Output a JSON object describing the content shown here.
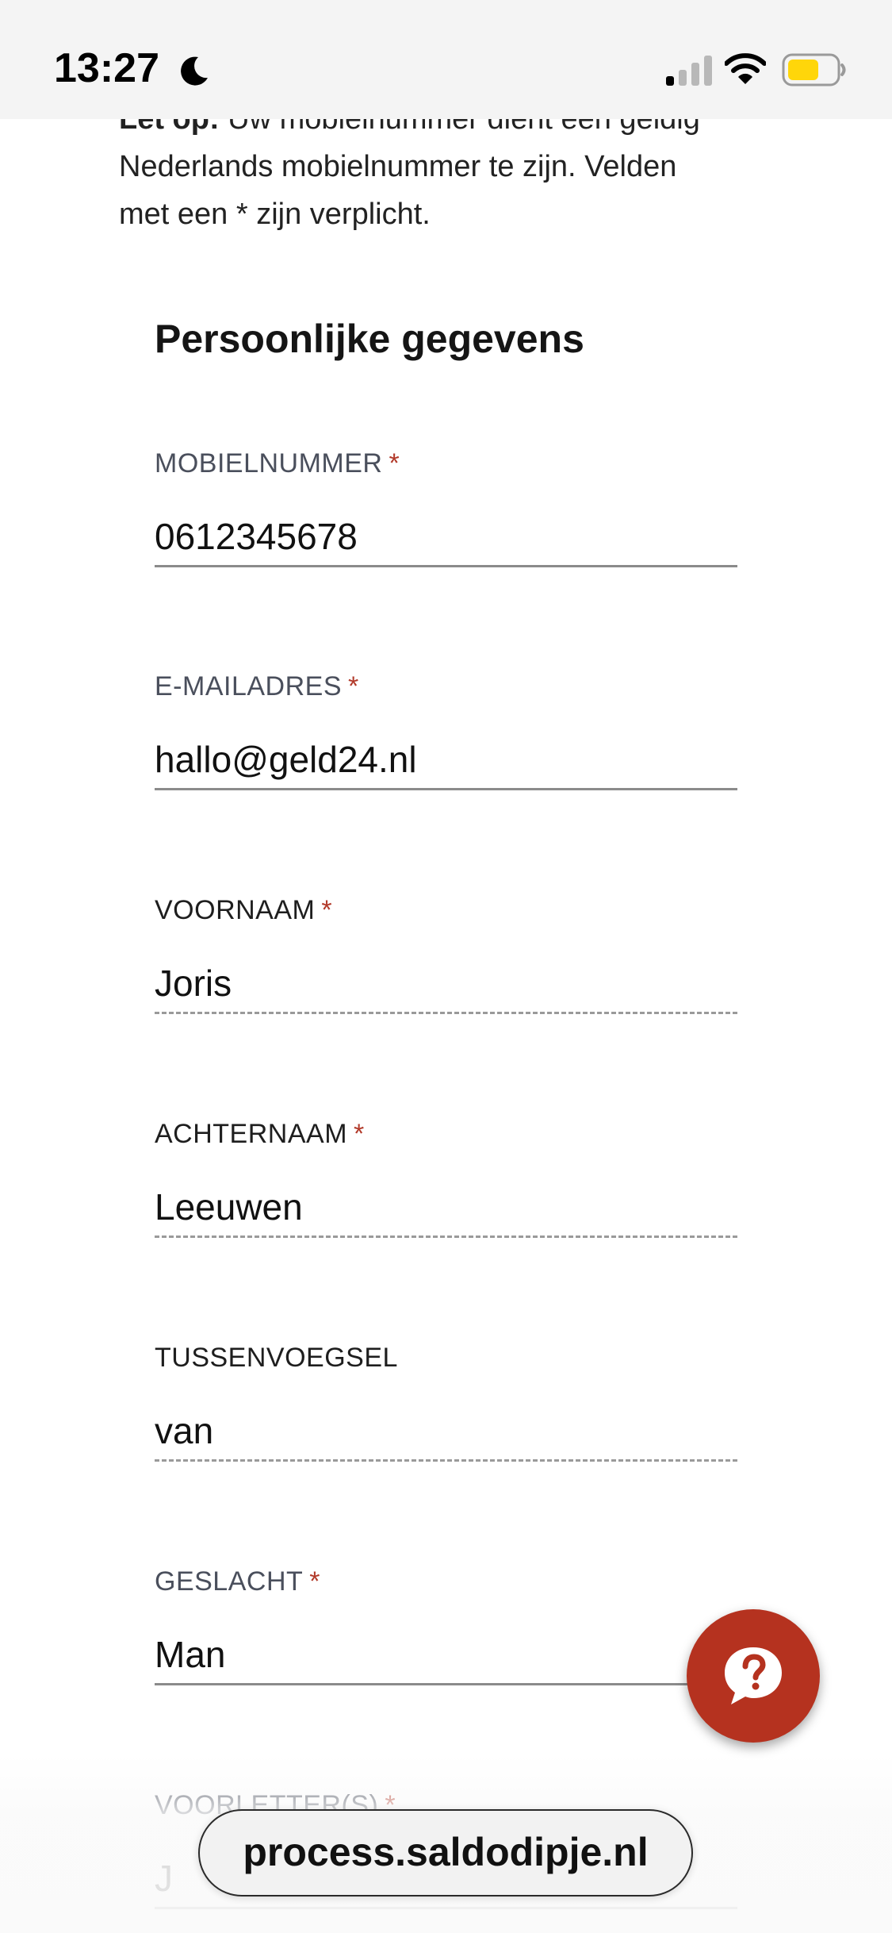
{
  "status_bar": {
    "time": "13:27",
    "icons": [
      "moon-icon",
      "signal-icon",
      "wifi-icon",
      "battery-icon"
    ],
    "battery_color": "#ffd60a"
  },
  "intro": {
    "bold_prefix": "Let op:",
    "line1_rest": " Uw mobielnummer dient een geldig",
    "line2": "Nederlands mobielnummer te zijn. Velden",
    "line3": "met een * zijn verplicht."
  },
  "section": {
    "title": "Persoonlijke gegevens"
  },
  "form": {
    "required_marker": "*",
    "fields": [
      {
        "label": "MOBIELNUMMER",
        "value": "0612345678",
        "required": true
      },
      {
        "label": "E-MAILADRES",
        "value": "hallo@geld24.nl",
        "required": true
      },
      {
        "label": "VOORNAAM",
        "value": "Joris",
        "required": true
      },
      {
        "label": "ACHTERNAAM",
        "value": "Leeuwen",
        "required": true
      },
      {
        "label": "TUSSENVOEGSEL",
        "value": "van",
        "required": false
      },
      {
        "label": "GESLACHT",
        "value": "Man",
        "required": true
      },
      {
        "label": "VOORLETTER(S)",
        "value": "J",
        "required": true
      }
    ]
  },
  "help_button": {
    "icon": "help-chat-icon",
    "color": "#b5321f"
  },
  "browser": {
    "url": "process.saldodipje.nl"
  },
  "colors": {
    "accent_required": "#b23a2a",
    "label_gray": "#4a4f5c"
  }
}
